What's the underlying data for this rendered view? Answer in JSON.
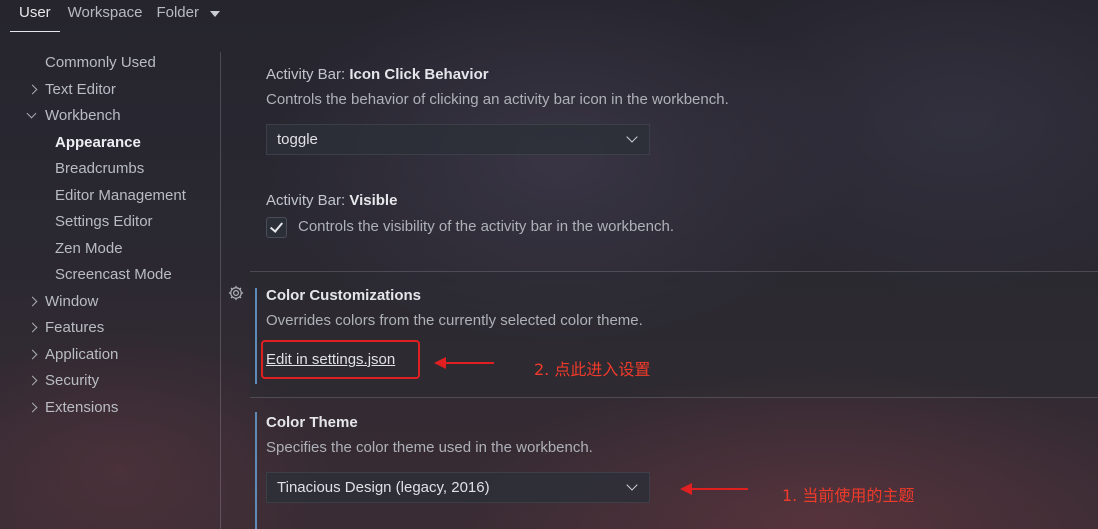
{
  "scope_tabs": {
    "user": "User",
    "workspace": "Workspace",
    "folder": "Folder"
  },
  "tree": {
    "commonly_used": "Commonly Used",
    "text_editor": "Text Editor",
    "workbench": "Workbench",
    "appearance": "Appearance",
    "breadcrumbs": "Breadcrumbs",
    "editor_management": "Editor Management",
    "settings_editor": "Settings Editor",
    "zen_mode": "Zen Mode",
    "screencast_mode": "Screencast Mode",
    "window": "Window",
    "features": "Features",
    "application": "Application",
    "security": "Security",
    "extensions": "Extensions"
  },
  "settings": {
    "icon_click": {
      "category": "Activity Bar: ",
      "name": "Icon Click Behavior",
      "description": "Controls the behavior of clicking an activity bar icon in the workbench.",
      "value": "toggle"
    },
    "visible": {
      "category": "Activity Bar: ",
      "name": "Visible",
      "description": "Controls the visibility of the activity bar in the workbench.",
      "checked": true
    },
    "color_customizations": {
      "name": "Color Customizations",
      "description": "Overrides colors from the currently selected color theme.",
      "link": "Edit in settings.json"
    },
    "color_theme": {
      "name": "Color Theme",
      "description": "Specifies the color theme used in the workbench.",
      "value": "Tinacious Design (legacy, 2016)"
    }
  },
  "annotations": {
    "step2": "2. 点此进入设置",
    "step1": "1. 当前使用的主题"
  },
  "colors": {
    "annotation_red": "#e02020",
    "modified_indicator": "#5d8ab6"
  },
  "icons": {
    "settings_gear": "gear-icon",
    "dropdown": "chevron-down-icon",
    "tree_collapsed": "chevron-right-icon",
    "tree_expanded": "chevron-down-icon",
    "checkbox": "check-icon"
  }
}
